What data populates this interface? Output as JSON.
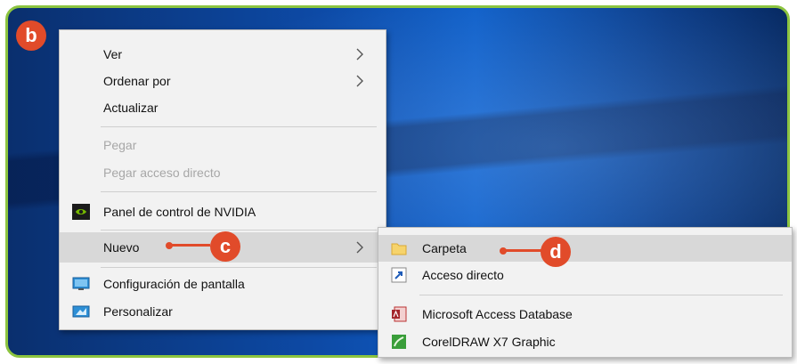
{
  "badges": {
    "b": "b",
    "c": "c",
    "d": "d"
  },
  "context_menu": {
    "items": [
      {
        "label": "Ver",
        "submenu": true
      },
      {
        "label": "Ordenar por",
        "submenu": true
      },
      {
        "label": "Actualizar"
      },
      {
        "label": "Pegar",
        "disabled": true
      },
      {
        "label": "Pegar acceso directo",
        "disabled": true
      },
      {
        "label": "Panel de control de NVIDIA",
        "icon": "nvidia-icon"
      },
      {
        "label": "Nuevo",
        "submenu": true,
        "highlighted": true
      },
      {
        "label": "Configuración de pantalla",
        "icon": "display-settings-icon"
      },
      {
        "label": "Personalizar",
        "icon": "personalize-icon"
      }
    ]
  },
  "submenu_nuevo": {
    "items": [
      {
        "label": "Carpeta",
        "icon": "folder-icon",
        "highlighted": true
      },
      {
        "label": "Acceso directo",
        "icon": "shortcut-icon"
      },
      {
        "label": "Microsoft Access Database",
        "icon": "access-icon"
      },
      {
        "label": "CorelDRAW X7 Graphic",
        "icon": "coreldraw-icon"
      }
    ]
  },
  "colors": {
    "accent_badge": "#e14b2a",
    "frame_border": "#8cc43f",
    "menu_bg": "#f2f2f2",
    "highlight": "#d8d8d8"
  }
}
